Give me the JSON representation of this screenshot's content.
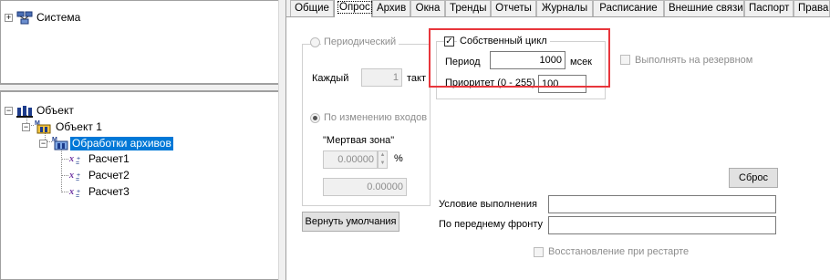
{
  "tree_top": {
    "root_label": "Система"
  },
  "tree_bottom": {
    "root_label": "Объект",
    "child_label": "Объект 1",
    "selected_label": "Обработки архивов",
    "leaves": [
      "Расчет1",
      "Расчет2",
      "Расчет3"
    ]
  },
  "tabs": [
    "Общие",
    "Опрос",
    "Архив",
    "Окна",
    "Тренды",
    "Отчеты",
    "Журналы",
    "Расписание",
    "Внешние связи",
    "Паспорт",
    "Права"
  ],
  "active_tab": "Опрос",
  "polling": {
    "periodic_label": "Периодический",
    "each_label": "Каждый",
    "each_value": "1",
    "tact_label": "такт",
    "by_change_label": "По изменению входов",
    "deadband_label": "\"Мертвая зона\"",
    "deadband_value": "0.00000",
    "percent_label": "%",
    "deadband_abs_value": "0.00000",
    "restore_defaults_label": "Вернуть умолчания"
  },
  "own_cycle": {
    "checkbox_label": "Собственный цикл",
    "checked": true,
    "period_label": "Период",
    "period_value": "1000",
    "period_unit": "мсек",
    "priority_label": "Приоритет (0 - 255)",
    "priority_value": "100"
  },
  "reserve": {
    "label": "Выполнять на резервном",
    "checked": false
  },
  "reset_label": "Сброс",
  "condition": {
    "label": "Условие выполнения",
    "value": ""
  },
  "front": {
    "label": "По переднему фронту",
    "value": ""
  },
  "restore_on_restart": {
    "label": "Восстановление при рестарте",
    "checked": false
  },
  "colors": {
    "selection": "#0078d7",
    "highlight_box": "#e8363c"
  }
}
